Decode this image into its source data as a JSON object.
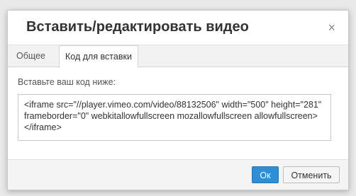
{
  "dialog": {
    "title": "Вставить/редактировать видео",
    "close_icon": "×",
    "tabs": [
      {
        "label": "Общее",
        "active": false
      },
      {
        "label": "Код для вставки",
        "active": true
      }
    ],
    "instruction": "Вставьте ваш код ниже:",
    "embed_code": "<iframe src=\"//player.vimeo.com/video/88132506\" width=\"500\" height=\"281\" frameborder=\"0\" webkitallowfullscreen mozallowfullscreen allowfullscreen></iframe>",
    "ok_label": "Ок",
    "cancel_label": "Отменить"
  },
  "colors": {
    "ok_button": "#2f8fd6",
    "background": "#e9e9e9"
  }
}
